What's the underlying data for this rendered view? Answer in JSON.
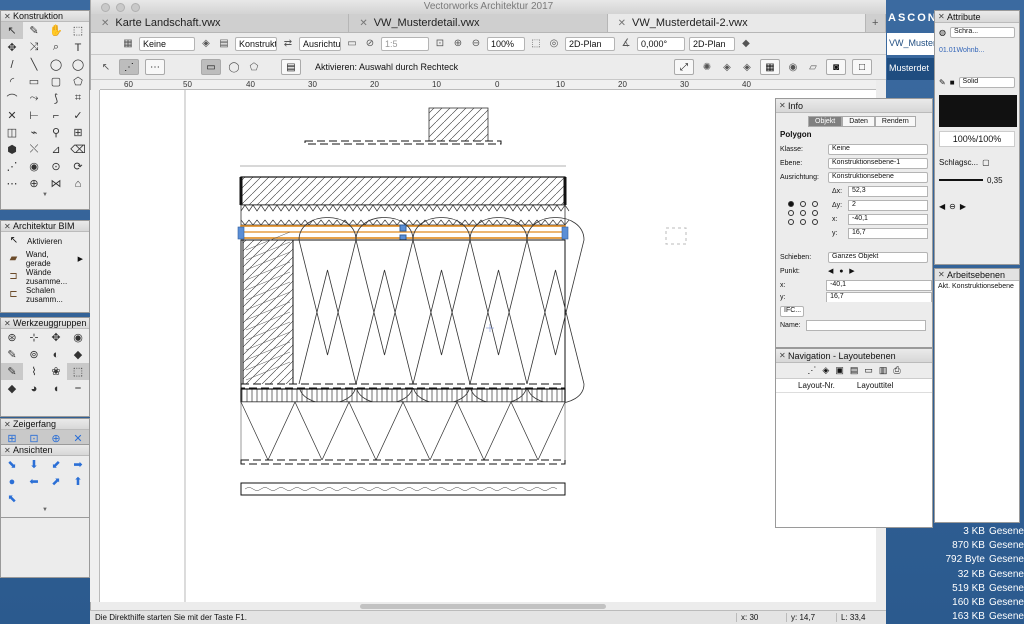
{
  "app": {
    "title": "Vectorworks Architektur 2017",
    "doc_title": "VW_Musterdetail-2.vwxx"
  },
  "tabs": [
    {
      "label": "Karte Landschaft.vwx",
      "active": false
    },
    {
      "label": "VW_Musterdetail.vwx",
      "active": false
    },
    {
      "label": "VW_Musterdetail-2.vwx",
      "active": true
    }
  ],
  "toolbar": {
    "class_value": "Keine",
    "layer_value": "Konstrukti...",
    "orientation_value": "Ausrichtun...",
    "scale_value": "1:5",
    "zoom_value": "100%",
    "view_value": "2D-Plan",
    "angle_value": "0,000°",
    "render_value": "2D-Plan"
  },
  "modebar": {
    "hint": "Aktivieren: Auswahl durch Rechteck"
  },
  "ruler": {
    "ticks": [
      "60",
      "50",
      "40",
      "30",
      "20",
      "10",
      "0",
      "10",
      "20",
      "30",
      "40"
    ]
  },
  "status": {
    "hint": "Die Direkthilfe starten Sie mit der Taste F1.",
    "x": "x: 30",
    "y": "y: 14,7",
    "l": "L: 33,4"
  },
  "palettes": {
    "konstruktion": {
      "title": "Konstruktion"
    },
    "bim": {
      "title": "Architektur BIM",
      "items": [
        {
          "label": "Aktivieren",
          "icon": "arrow-icon"
        },
        {
          "label": "Wand, gerade",
          "icon": "wall-icon"
        },
        {
          "label": "Wände zusamme...",
          "icon": "wall-join-icon"
        },
        {
          "label": "Schalen zusamm...",
          "icon": "shell-join-icon"
        }
      ]
    },
    "werkzeuggruppen": {
      "title": "Werkzeuggruppen"
    },
    "zeigerfang": {
      "title": "Zeigerfang"
    },
    "ansichten": {
      "title": "Ansichten"
    }
  },
  "info": {
    "title": "Info",
    "tabs": [
      "Objekt",
      "Daten",
      "Rendern"
    ],
    "object_type": "Polygon",
    "klasse_label": "Klasse:",
    "klasse_value": "Keine",
    "ebene_label": "Ebene:",
    "ebene_value": "Konstruktionsebene-1",
    "ausrichtung_label": "Ausrichtung:",
    "ausrichtung_value": "Konstruktionsebene",
    "dx_label": "Δx:",
    "dx_value": "52,3",
    "dy_label": "Δy:",
    "dy_value": "2",
    "x_label": "x:",
    "x_value": "-40,1",
    "y_label": "y:",
    "y_value": "16,7",
    "schieben_label": "Schieben:",
    "schieben_value": "Ganzes Objekt",
    "punkt_label": "Punkt:",
    "px_label": "x:",
    "px_value": "-40,1",
    "py_label": "y:",
    "py_value": "16,7",
    "ifc_label": "IFC...",
    "name_label": "Name:"
  },
  "navigation": {
    "title": "Navigation - Layoutebenen",
    "col1": "Layout-Nr.",
    "col2": "Layouttitel"
  },
  "attribute": {
    "title": "Attribute",
    "fill_style": "Schra...",
    "hatch_name": "01.01Wohnb...",
    "pen_style": "Solid",
    "opacity": "100%/100%",
    "shadow_label": "Schlagsc...",
    "line_weight": "0,35",
    "fill_color": "#111111"
  },
  "arbeitsebenen": {
    "title": "Arbeitsebenen",
    "item": "Akt. Konstruktionsebene"
  },
  "desktop": {
    "ascona": "ASCONA",
    "bar1": "VW_Muster",
    "bar2": "Musterdet",
    "files": [
      {
        "size": "3 KB",
        "kind": "Gesene"
      },
      {
        "size": "870 KB",
        "kind": "Gesene"
      },
      {
        "size": "792 Byte",
        "kind": "Gesene"
      },
      {
        "size": "32 KB",
        "kind": "Gesene"
      },
      {
        "size": "519 KB",
        "kind": "Gesene"
      },
      {
        "size": "160 KB",
        "kind": "Gesene"
      },
      {
        "size": "163 KB",
        "kind": "Gesene"
      }
    ]
  }
}
